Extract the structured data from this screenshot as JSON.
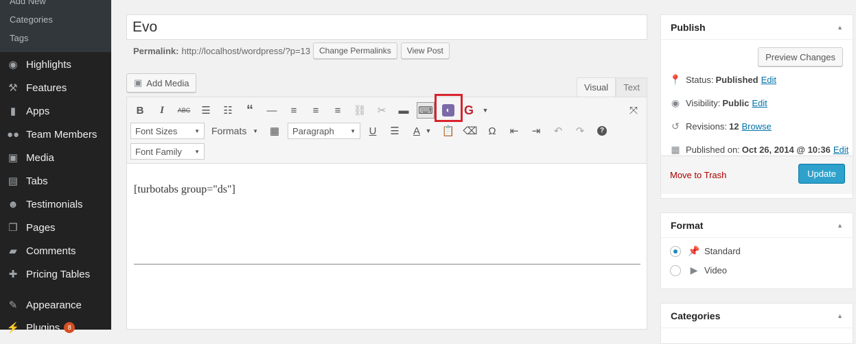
{
  "sidebar": {
    "sub_items": [
      "Add New",
      "Categories",
      "Tags"
    ],
    "items": [
      {
        "label": "Highlights",
        "icon": "eye-icon"
      },
      {
        "label": "Features",
        "icon": "tools-icon"
      },
      {
        "label": "Apps",
        "icon": "phone-icon"
      },
      {
        "label": "Team Members",
        "icon": "group-icon"
      },
      {
        "label": "Media",
        "icon": "media-icon"
      },
      {
        "label": "Tabs",
        "icon": "tabs-icon"
      },
      {
        "label": "Testimonials",
        "icon": "person-icon"
      },
      {
        "label": "Pages",
        "icon": "pages-icon"
      },
      {
        "label": "Comments",
        "icon": "comment-icon"
      },
      {
        "label": "Pricing Tables",
        "icon": "plus-icon"
      },
      {
        "label": "Appearance",
        "icon": "brush-icon"
      },
      {
        "label": "Plugins",
        "icon": "plugin-icon",
        "badge": "8"
      }
    ]
  },
  "post": {
    "title": "Evo",
    "permalink_label": "Permalink:",
    "permalink_url": "http://localhost/wordpress/?p=13",
    "change_permalinks": "Change Permalinks",
    "view_post": "View Post"
  },
  "editor": {
    "add_media": "Add Media",
    "tab_visual": "Visual",
    "tab_text": "Text",
    "font_sizes": "Font Sizes",
    "formats": "Formats",
    "paragraph": "Paragraph",
    "font_family": "Font Family",
    "content": "[turbotabs group=\"ds\"]"
  },
  "publish": {
    "title": "Publish",
    "preview": "Preview Changes",
    "status_label": "Status:",
    "status_value": "Published",
    "visibility_label": "Visibility:",
    "visibility_value": "Public",
    "revisions_label": "Revisions:",
    "revisions_value": "12",
    "browse": "Browse",
    "published_on_label": "Published on:",
    "published_on_value": "Oct 26, 2014 @ 10:36",
    "edit": "Edit",
    "trash": "Move to Trash",
    "update": "Update"
  },
  "format": {
    "title": "Format",
    "options": [
      "Standard",
      "Video"
    ],
    "selected": "Standard"
  },
  "categories": {
    "title": "Categories"
  },
  "colors": {
    "admin_bar": "#222222",
    "accent": "#2ea2cc",
    "highlight": "#d9232d"
  }
}
